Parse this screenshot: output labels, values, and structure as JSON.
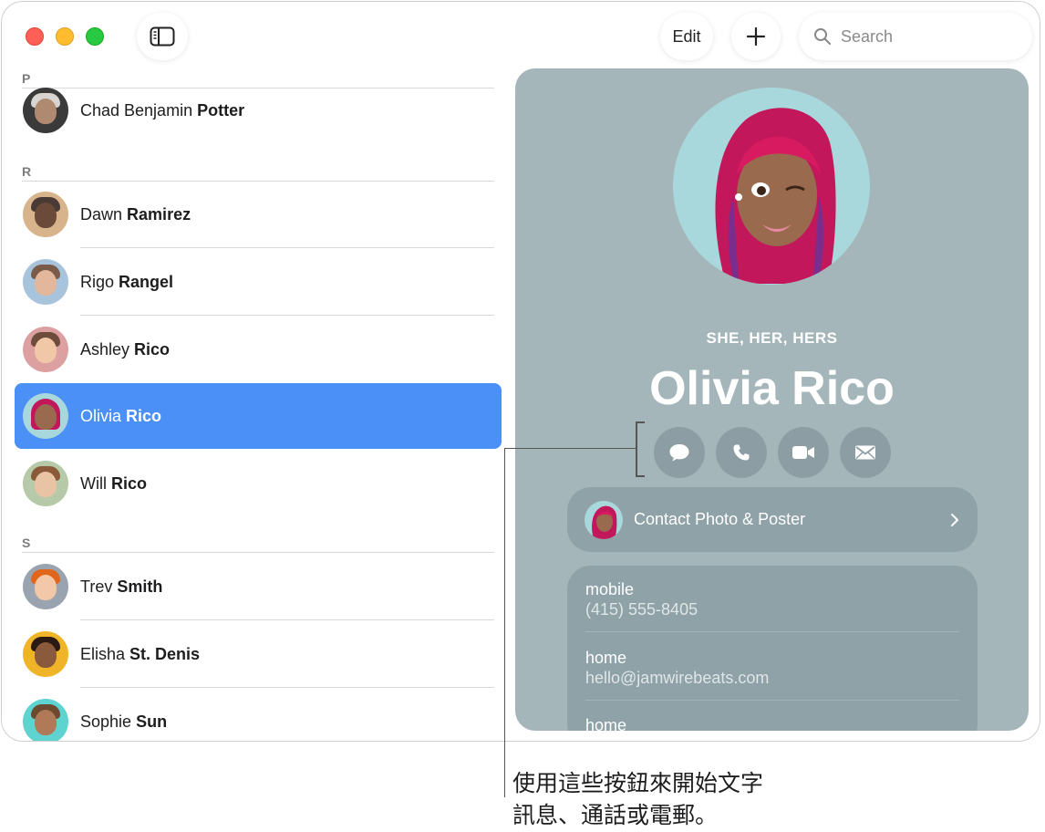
{
  "toolbar": {
    "edit_label": "Edit",
    "add_icon": "plus-icon",
    "sidebar_icon": "sidebar-icon",
    "search_placeholder": "Search"
  },
  "contacts_list": {
    "sections": [
      {
        "letter": "P",
        "contacts": [
          {
            "first": "Chad Benjamin",
            "last": "Potter"
          }
        ]
      },
      {
        "letter": "R",
        "contacts": [
          {
            "first": "Dawn",
            "last": "Ramirez"
          },
          {
            "first": "Rigo",
            "last": "Rangel"
          },
          {
            "first": "Ashley",
            "last": "Rico"
          },
          {
            "first": "Olivia",
            "last": "Rico",
            "selected": true
          },
          {
            "first": "Will",
            "last": "Rico"
          }
        ]
      },
      {
        "letter": "S",
        "contacts": [
          {
            "first": "Trev",
            "last": "Smith"
          },
          {
            "first": "Elisha",
            "last": "St. Denis"
          },
          {
            "first": "Sophie",
            "last": "Sun"
          }
        ]
      }
    ]
  },
  "detail": {
    "pronouns": "SHE, HER, HERS",
    "name": "Olivia Rico",
    "actions": [
      "message-icon",
      "phone-icon",
      "video-icon",
      "mail-icon"
    ],
    "poster_label": "Contact Photo & Poster",
    "fields": [
      {
        "label": "mobile",
        "value": "(415) 555-8405"
      },
      {
        "label": "home",
        "value": "hello@jamwirebeats.com"
      },
      {
        "label": "home",
        "value": ""
      }
    ]
  },
  "callout": {
    "line1": "使用這些按鈕來開始文字",
    "line2": "訊息、通話或電郵。"
  },
  "colors": {
    "selection": "#4a90f6",
    "detail_background": "#a5b6bb"
  }
}
